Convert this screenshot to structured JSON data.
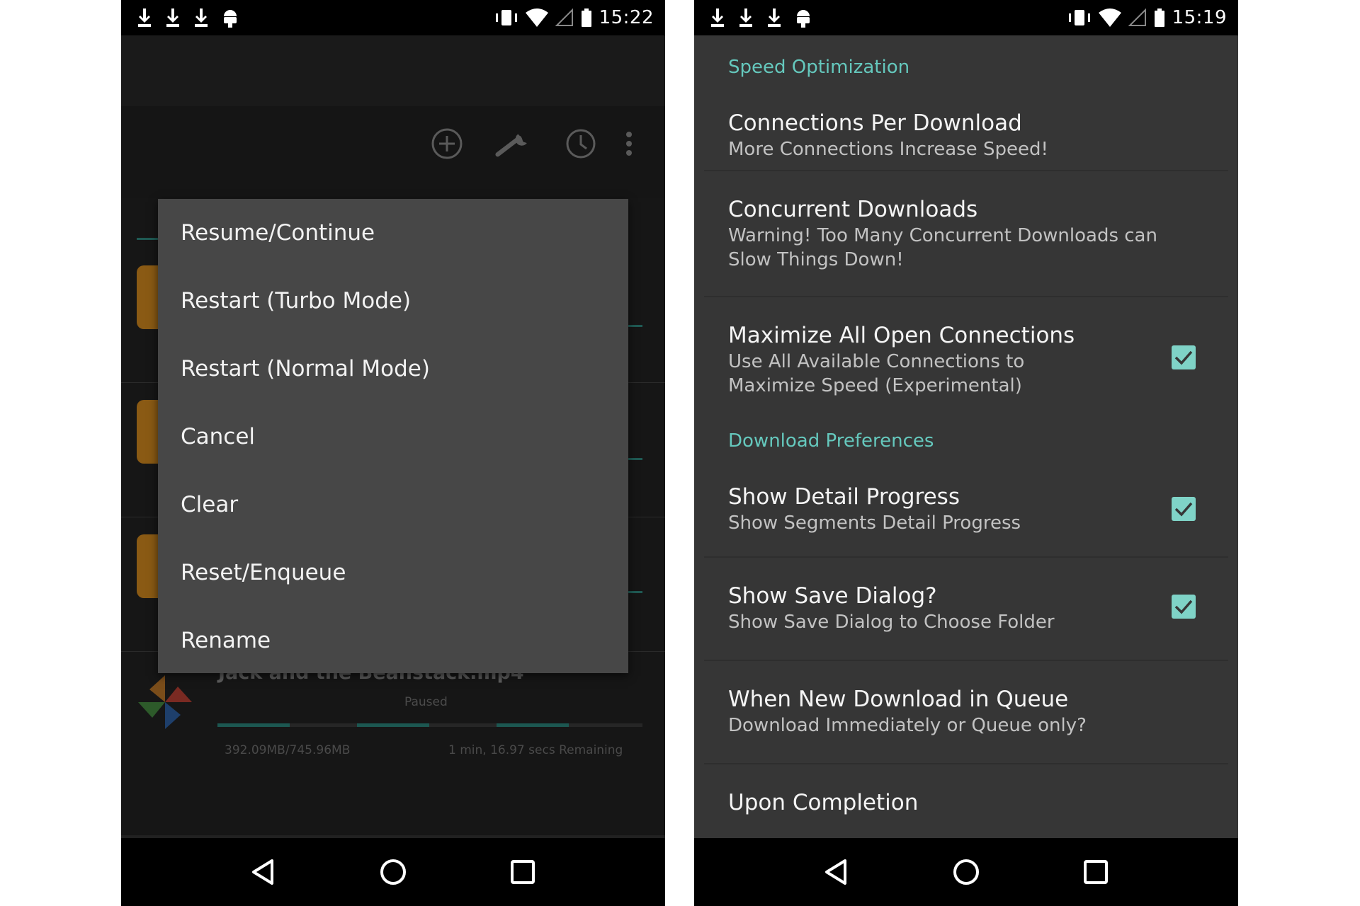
{
  "left_phone": {
    "status_bar": {
      "time": "15:22",
      "left_icons": [
        "download-icon",
        "download-icon",
        "download-icon",
        "android-icon"
      ],
      "right_icons": [
        "vibrate-icon",
        "wifi-icon",
        "signal-icon",
        "battery-icon"
      ]
    },
    "toolbar_icons": [
      "add-circle-icon",
      "wrench-icon",
      "clock-icon",
      "overflow-menu-icon"
    ],
    "context_menu": {
      "items": [
        "Resume/Continue",
        "Restart (Turbo Mode)",
        "Restart (Normal Mode)",
        "Cancel",
        "Clear",
        "Reset/Enqueue",
        "Rename"
      ]
    },
    "background_download": {
      "file_name": "Jack and the Beanstack.mp4",
      "status": "Paused",
      "size": "392.09MB/745.96MB",
      "remaining": "1 min, 16.97 secs Remaining"
    },
    "nav_bar": [
      "back-icon",
      "home-icon",
      "recents-icon"
    ]
  },
  "right_phone": {
    "status_bar": {
      "time": "15:19",
      "left_icons": [
        "download-icon",
        "download-icon",
        "download-icon",
        "android-icon"
      ],
      "right_icons": [
        "vibrate-icon",
        "wifi-icon",
        "signal-icon",
        "battery-icon"
      ]
    },
    "sections": [
      {
        "header": "Speed Optimization",
        "prefs": [
          {
            "title": "Connections Per Download",
            "summary": "More Connections Increase Speed!",
            "checked": null
          },
          {
            "title": "Concurrent Downloads",
            "summary": "Warning! Too Many Concurrent Downloads can Slow Things Down!",
            "checked": null
          },
          {
            "title": "Maximize All Open Connections",
            "summary": "Use All Available Connections to Maximize Speed (Experimental)",
            "checked": true
          }
        ]
      },
      {
        "header": "Download Preferences",
        "prefs": [
          {
            "title": "Show Detail Progress",
            "summary": "Show Segments Detail Progress",
            "checked": true
          },
          {
            "title": "Show Save Dialog?",
            "summary": "Show Save Dialog to Choose Folder",
            "checked": true
          },
          {
            "title": "When New Download in Queue",
            "summary": "Download Immediately or Queue only?",
            "checked": null
          },
          {
            "title": "Upon Completion",
            "summary": "",
            "checked": null
          }
        ]
      }
    ],
    "nav_bar": [
      "back-icon",
      "home-icon",
      "recents-icon"
    ]
  },
  "colors": {
    "accent": "#65c8bd",
    "checkbox": "#7fd3c7",
    "menu_bg": "#474747",
    "settings_bg": "#363636"
  }
}
